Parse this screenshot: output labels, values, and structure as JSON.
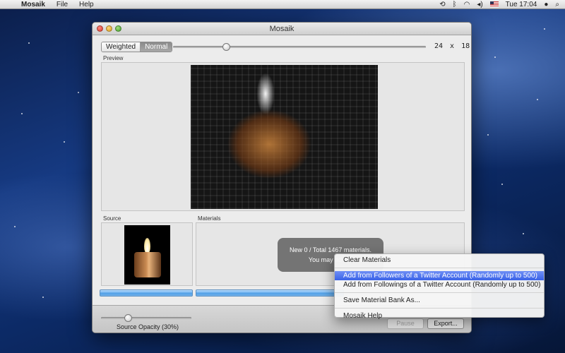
{
  "menubar": {
    "app_name": "Mosaik",
    "items": [
      "File",
      "Help"
    ],
    "clock": "Tue 17:04"
  },
  "window": {
    "title": "Mosaik",
    "mode_toggle": {
      "options": [
        "Weighted",
        "Normal"
      ],
      "selected": "Normal"
    },
    "grid_size": {
      "columns": "24",
      "separator": "x",
      "rows": "18"
    },
    "grid_slider_value": 0.2,
    "preview_label": "Preview",
    "source_label": "Source",
    "materials_label": "Materials",
    "hud": {
      "line1": "New 0 / Total 1467 materials.",
      "line2": "You may add m"
    },
    "source_opacity_label": "Source Opacity (30%)",
    "source_opacity_value": 0.3,
    "pause_button": "Pause",
    "export_button": "Export..."
  },
  "context_menu": {
    "items": [
      {
        "label": "Clear Materials"
      },
      {
        "label": "Add from Followers of a Twitter Account (Randomly up to 500)",
        "selected": true
      },
      {
        "label": "Add from Followings of a Twitter Account (Randomly up to 500)"
      },
      {
        "label": "Save Material Bank As..."
      },
      {
        "label": "Mosaik Help"
      }
    ]
  },
  "colors": {
    "selection": "#3a62e8",
    "progress": "#4f9fe6"
  }
}
